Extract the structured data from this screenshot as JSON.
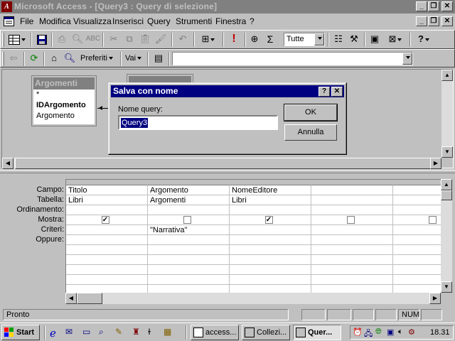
{
  "app": {
    "title": "Microsoft Access - [Query3 : Query di selezione]",
    "icon_letter": "A"
  },
  "window_controls": {
    "minimize": "_",
    "restore": "❐",
    "close": "✕"
  },
  "menu": [
    {
      "label": "File"
    },
    {
      "label": "Modifica"
    },
    {
      "label": "Visualizza"
    },
    {
      "label": "Inserisci"
    },
    {
      "label": "Query"
    },
    {
      "label": "Strumenti"
    },
    {
      "label": "Finestra"
    },
    {
      "label": "?"
    }
  ],
  "toolbar": {
    "top_values_value": "Tutte",
    "exclamation": "!",
    "sigma": "Σ",
    "help": "?"
  },
  "web_toolbar": {
    "favorites_label": "Preferiti",
    "goto_label": "Vai",
    "address_value": ""
  },
  "field_list": {
    "title": "Argomenti",
    "fields": [
      "*",
      "IDArgomento",
      "Argomento"
    ]
  },
  "dialog": {
    "title": "Salva con nome",
    "help_button": "?",
    "close_button": "✕",
    "query_label": "Nome query:",
    "query_value": "Query3",
    "ok_label": "OK",
    "cancel_label": "Annulla"
  },
  "grid": {
    "row_labels": [
      "Campo:",
      "Tabella:",
      "Ordinamento:",
      "Mostra:",
      "Criteri:",
      "Oppure:"
    ],
    "columns": [
      {
        "campo": "Titolo",
        "tabella": "Libri",
        "ordinamento": "",
        "mostra": true,
        "criteri": "",
        "oppure": ""
      },
      {
        "campo": "Argomento",
        "tabella": "Argomenti",
        "ordinamento": "",
        "mostra": false,
        "criteri": "\"Narrativa\"",
        "oppure": ""
      },
      {
        "campo": "NomeEditore",
        "tabella": "Libri",
        "ordinamento": "",
        "mostra": true,
        "criteri": "",
        "oppure": ""
      },
      {
        "campo": "",
        "tabella": "",
        "ordinamento": "",
        "mostra": false,
        "criteri": "",
        "oppure": ""
      },
      {
        "campo": "",
        "tabella": "",
        "ordinamento": "",
        "mostra": false,
        "criteri": "",
        "oppure": ""
      }
    ]
  },
  "status": {
    "text": "Pronto",
    "num": "NUM"
  },
  "taskbar": {
    "start_label": "Start",
    "tasks": [
      {
        "label": "access..."
      },
      {
        "label": "Collezi..."
      },
      {
        "label": "Quer..."
      }
    ],
    "clock": "18.31"
  },
  "colors": {
    "title_inactive": "#808080",
    "dialog_title": "#000080",
    "face": "#c0c0c0"
  }
}
